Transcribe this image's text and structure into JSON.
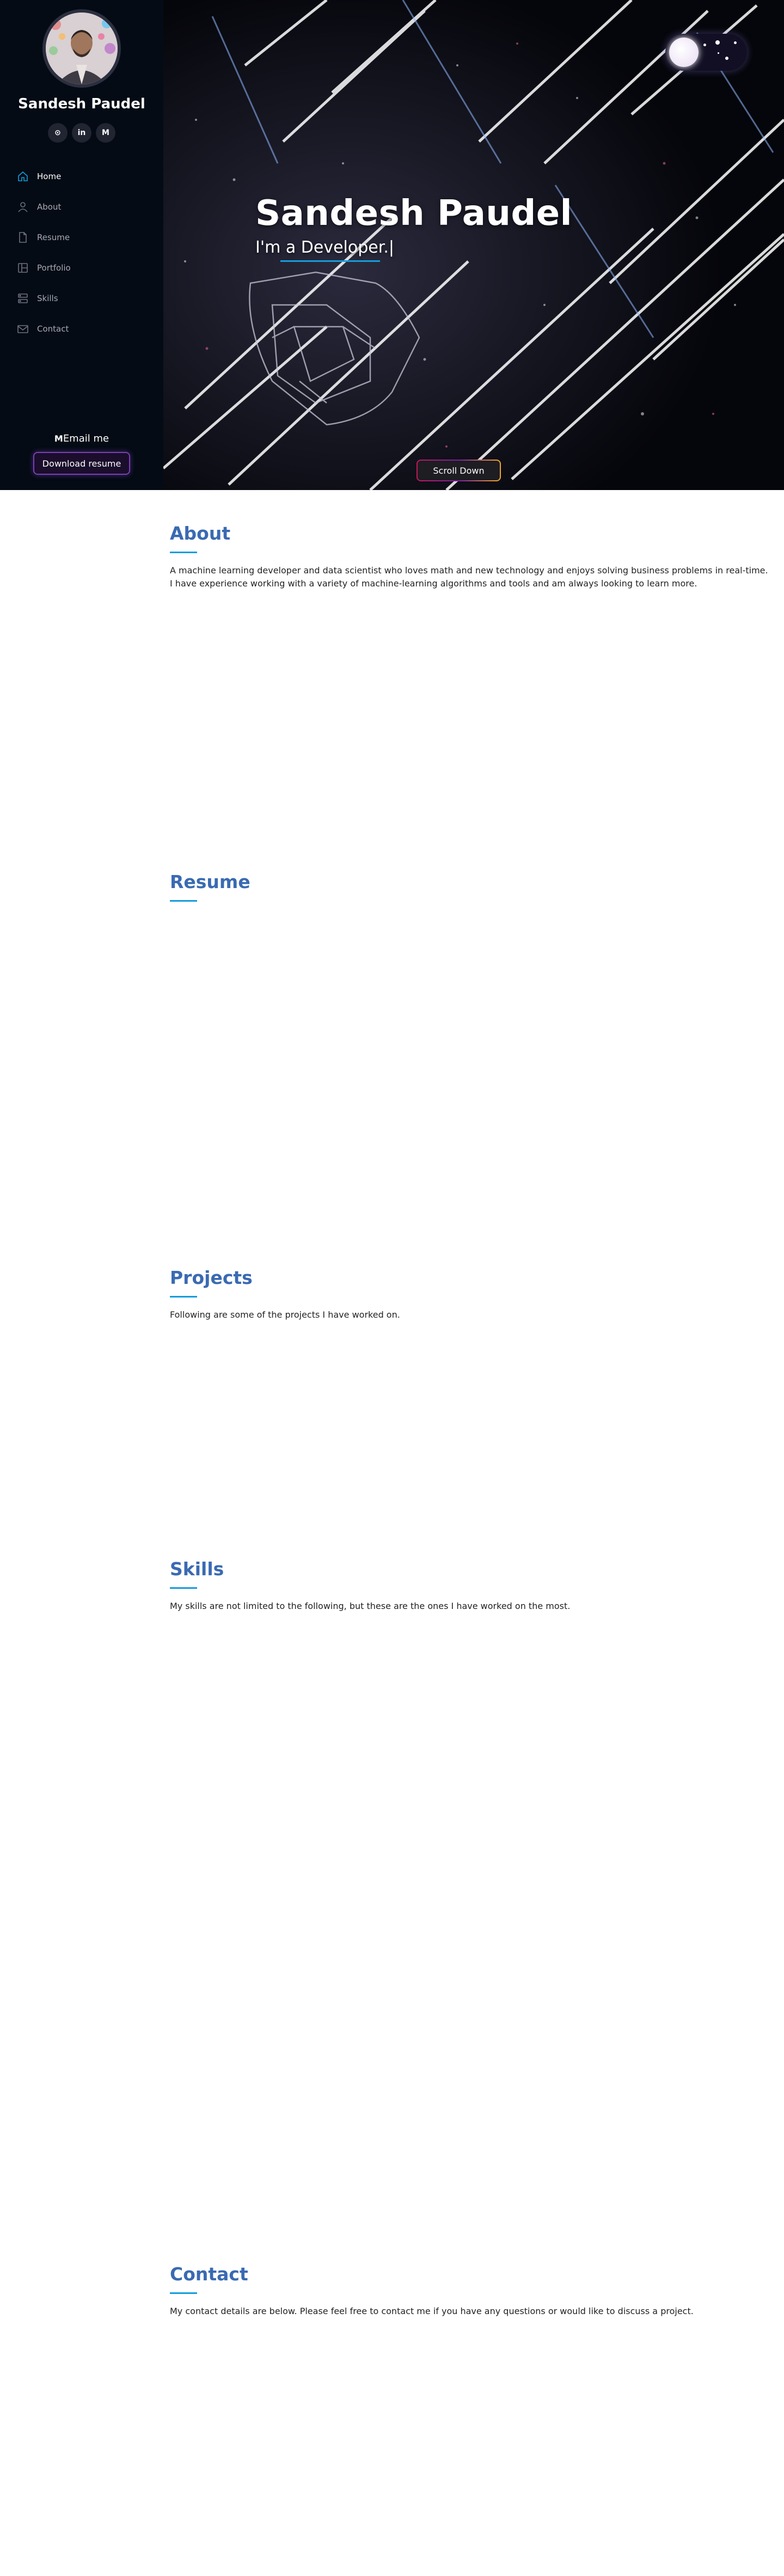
{
  "sidebar": {
    "name": "Sandesh Paudel",
    "social": [
      {
        "icon": "github-icon",
        "glyph": "⊙"
      },
      {
        "icon": "linkedin-icon",
        "glyph": "in"
      },
      {
        "icon": "medium-icon",
        "glyph": "M"
      }
    ],
    "nav": [
      {
        "label": "Home",
        "icon": "home-icon"
      },
      {
        "label": "About",
        "icon": "user-icon"
      },
      {
        "label": "Resume",
        "icon": "file-icon"
      },
      {
        "label": "Portfolio",
        "icon": "portfolio-icon"
      },
      {
        "label": "Skills",
        "icon": "server-icon"
      },
      {
        "label": "Contact",
        "icon": "envelope-icon"
      }
    ],
    "email_label": "Email me",
    "download_label": "Download resume"
  },
  "hero": {
    "title": "Sandesh Paudel",
    "subtitle": "I'm a Developer.|",
    "scroll_label": "Scroll Down"
  },
  "about": {
    "title": "About",
    "text": "A machine learning developer and data scientist who loves math and new technology and enjoys solving business problems in real-time. I have experience working with a variety of machine-learning algorithms and tools and am always looking to learn more."
  },
  "resume": {
    "title": "Resume"
  },
  "projects": {
    "title": "Projects",
    "text": "Following are some of the projects I have worked on."
  },
  "skills": {
    "title": "Skills",
    "text": "My skills are not limited to the following, but these are the ones I have worked on the most."
  },
  "contact": {
    "title": "Contact",
    "text": "My contact details are below. Please feel free to contact me if you have any questions or would like to discuss a project."
  },
  "colors": {
    "accent": "#149ddd",
    "heading": "#3a6ab2",
    "sidebar_bg": "#040b14",
    "button_border": "#7b3fb3"
  }
}
